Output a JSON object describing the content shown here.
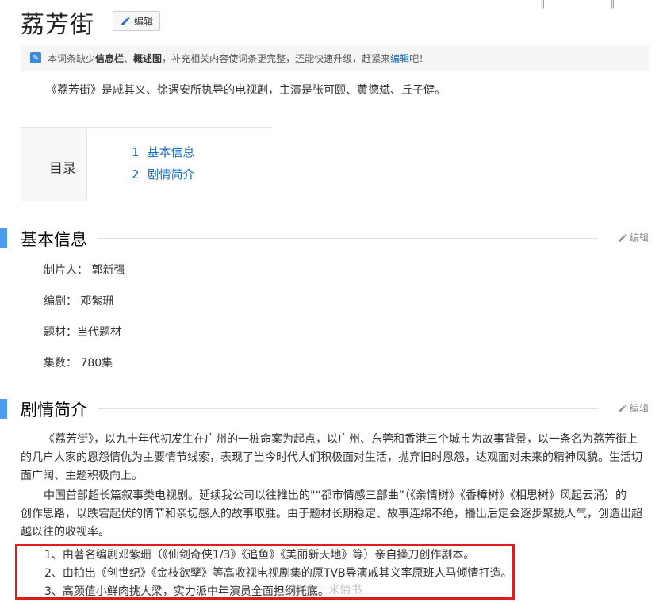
{
  "page": {
    "title": "荔芳街",
    "edit_label": "编辑"
  },
  "notice": {
    "prefix": "本词条缺少",
    "bold1": "信息栏",
    "sep": "、",
    "bold2": "概述图",
    "middle": "，补充相关内容使词条更完整，还能快速升级，赶紧来",
    "link": "编辑",
    "suffix": "吧！"
  },
  "summary": "《荔芳街》是戚其义、徐遇安所执导的电视剧，主演是张可颐、黄德斌、丘子健。",
  "toc": {
    "label": "目录",
    "items": [
      {
        "num": "1",
        "label": "基本信息"
      },
      {
        "num": "2",
        "label": "剧情简介"
      }
    ]
  },
  "basic_info": {
    "title": "基本信息",
    "edit_label": "编辑",
    "rows": [
      "制片人： 郭新强",
      "编剧： 邓紫珊",
      "题材：当代题材",
      "集数： 780集"
    ]
  },
  "plot": {
    "title": "剧情简介",
    "edit_label": "编辑",
    "para1_lines": [
      "《荔芳街》，以九十年代初发生在广州的一桩命案为起点，以广州、东莞和香港三个城市为故事背景，以一条名为荔芳街上",
      "的几户人家的恩怨情仇为主要情节线索，表现了当今时代人们积极面对生活，抛弃旧时恩怨，达观面对未来的精神风貌。生活切",
      "面广阔、主题积极向上。"
    ],
    "para2_lines": [
      "中国首部超长篇叙事类电视剧。延续我公司以往推出的\"“都市情感三部曲”（《亲情树》《香樟树》《相思树》风起云涌）的",
      "创作思路，以跌宕起伏的情节和亲切感人的故事取胜。由于题材长期稳定、故事连绵不绝，播出后定会逐步聚拢人气，创造出超",
      "越以往的收视率。"
    ],
    "highlights": [
      "1、由著名编剧邓紫珊（《仙剑奇侠1/3》《追鱼》《美丽新天地》等）亲自操刀创作剧本。",
      "2、由拍出《创世纪》《金枝欲孽》等高收视电视剧集的原TVB导演戚其义率原班人马倾情打造。",
      "3、高颜值小鲜肉挑大梁，实力派中年演员全面担纲托底。"
    ]
  },
  "watermark": "微博 一米情书",
  "colors": {
    "link": "#136ec2",
    "section_bar": "#4f9cee",
    "highlight_border": "#e11b1b"
  }
}
